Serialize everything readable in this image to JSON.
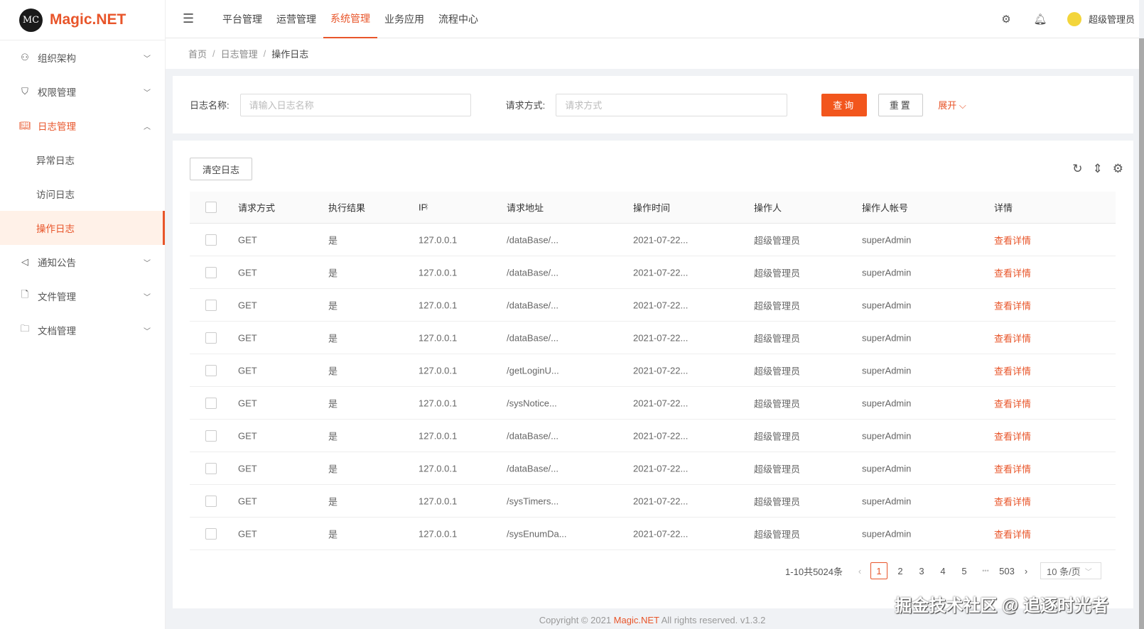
{
  "app": {
    "name": "Magic.NET",
    "logo_text": "MC"
  },
  "topnav": {
    "items": [
      {
        "label": "平台管理"
      },
      {
        "label": "运营管理"
      },
      {
        "label": "系统管理",
        "active": true
      },
      {
        "label": "业务应用"
      },
      {
        "label": "流程中心"
      }
    ],
    "user": "超级管理员"
  },
  "sidebar": {
    "items": [
      {
        "label": "组织架构",
        "icon": "user-icon"
      },
      {
        "label": "权限管理",
        "icon": "shield-icon"
      },
      {
        "label": "日志管理",
        "icon": "book-icon",
        "open": true,
        "children": [
          {
            "label": "异常日志"
          },
          {
            "label": "访问日志"
          },
          {
            "label": "操作日志",
            "selected": true
          }
        ]
      },
      {
        "label": "通知公告",
        "icon": "speaker-icon"
      },
      {
        "label": "文件管理",
        "icon": "file-icon"
      },
      {
        "label": "文档管理",
        "icon": "folder-icon"
      }
    ]
  },
  "breadcrumb": [
    "首页",
    "日志管理",
    "操作日志"
  ],
  "search": {
    "name_label": "日志名称:",
    "name_placeholder": "请输入日志名称",
    "method_label": "请求方式:",
    "method_placeholder": "请求方式",
    "query": "查询",
    "reset": "重置",
    "expand": "展开"
  },
  "table": {
    "clear_button": "清空日志",
    "columns": [
      "请求方式",
      "执行结果",
      "IP",
      "请求地址",
      "操作时间",
      "操作人",
      "操作人帐号",
      "详情"
    ],
    "rows": [
      [
        "GET",
        "是",
        "127.0.0.1",
        "/dataBase/...",
        "2021-07-22...",
        "超级管理员",
        "superAdmin",
        "查看详情"
      ],
      [
        "GET",
        "是",
        "127.0.0.1",
        "/dataBase/...",
        "2021-07-22...",
        "超级管理员",
        "superAdmin",
        "查看详情"
      ],
      [
        "GET",
        "是",
        "127.0.0.1",
        "/dataBase/...",
        "2021-07-22...",
        "超级管理员",
        "superAdmin",
        "查看详情"
      ],
      [
        "GET",
        "是",
        "127.0.0.1",
        "/dataBase/...",
        "2021-07-22...",
        "超级管理员",
        "superAdmin",
        "查看详情"
      ],
      [
        "GET",
        "是",
        "127.0.0.1",
        "/getLoginU...",
        "2021-07-22...",
        "超级管理员",
        "superAdmin",
        "查看详情"
      ],
      [
        "GET",
        "是",
        "127.0.0.1",
        "/sysNotice...",
        "2021-07-22...",
        "超级管理员",
        "superAdmin",
        "查看详情"
      ],
      [
        "GET",
        "是",
        "127.0.0.1",
        "/dataBase/...",
        "2021-07-22...",
        "超级管理员",
        "superAdmin",
        "查看详情"
      ],
      [
        "GET",
        "是",
        "127.0.0.1",
        "/dataBase/...",
        "2021-07-22...",
        "超级管理员",
        "superAdmin",
        "查看详情"
      ],
      [
        "GET",
        "是",
        "127.0.0.1",
        "/sysTimers...",
        "2021-07-22...",
        "超级管理员",
        "superAdmin",
        "查看详情"
      ],
      [
        "GET",
        "是",
        "127.0.0.1",
        "/sysEnumDa...",
        "2021-07-22...",
        "超级管理员",
        "superAdmin",
        "查看详情"
      ]
    ]
  },
  "pagination": {
    "total_text": "1-10共5024条",
    "pages": [
      "1",
      "2",
      "3",
      "4",
      "5",
      "•••",
      "503"
    ],
    "current": "1",
    "page_size": "10 条/页"
  },
  "footer": {
    "prefix": "Copyright © 2021 ",
    "brand": "Magic.NET",
    "suffix": " All rights reserved. v1.3.2"
  },
  "watermark": "掘金技术社区 @ 追逐时光者",
  "colors": {
    "accent": "#e8552a"
  }
}
